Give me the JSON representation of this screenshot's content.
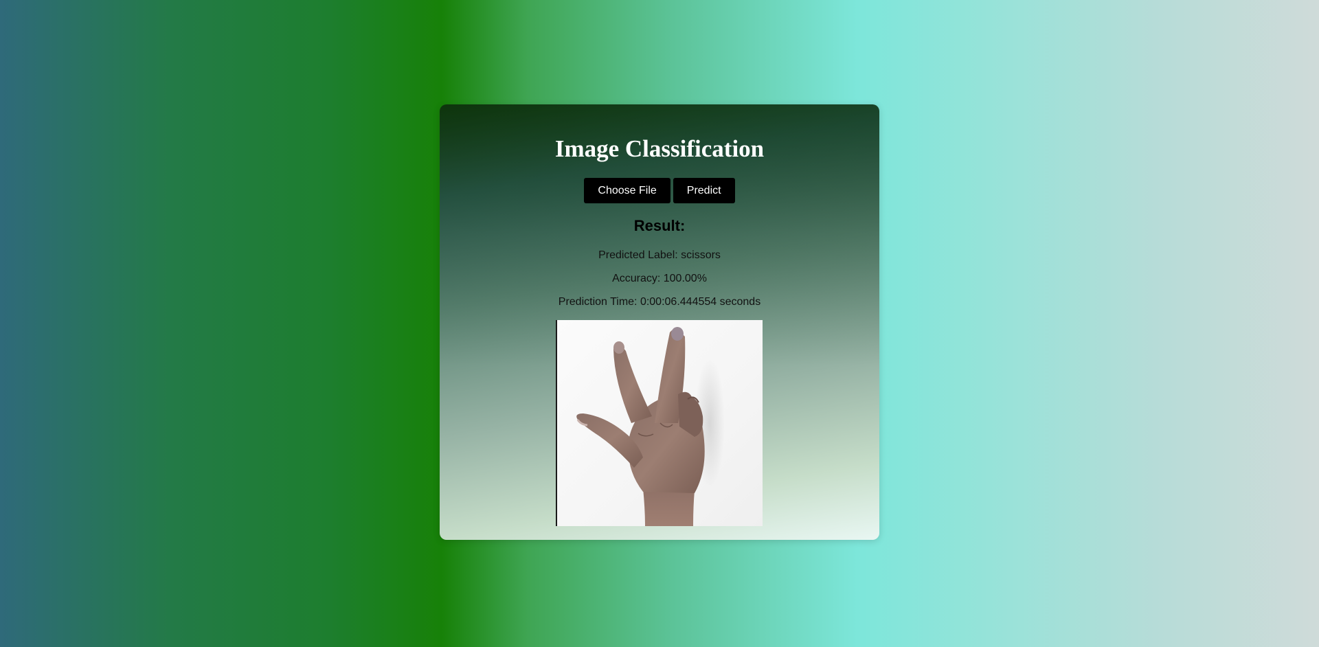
{
  "app": {
    "title": "Image Classification"
  },
  "controls": {
    "choose_file_label": "Choose File",
    "predict_label": "Predict"
  },
  "result": {
    "heading": "Result:",
    "predicted_label": "Predicted Label: scissors",
    "accuracy": "Accuracy: 100.00%",
    "prediction_time": "Prediction Time: 0:00:06.444554 seconds"
  },
  "preview": {
    "icon": "hand-scissors-gesture-image"
  },
  "colors": {
    "button_bg": "#000000",
    "button_text": "#ffffff",
    "title_text": "#ffffff"
  }
}
